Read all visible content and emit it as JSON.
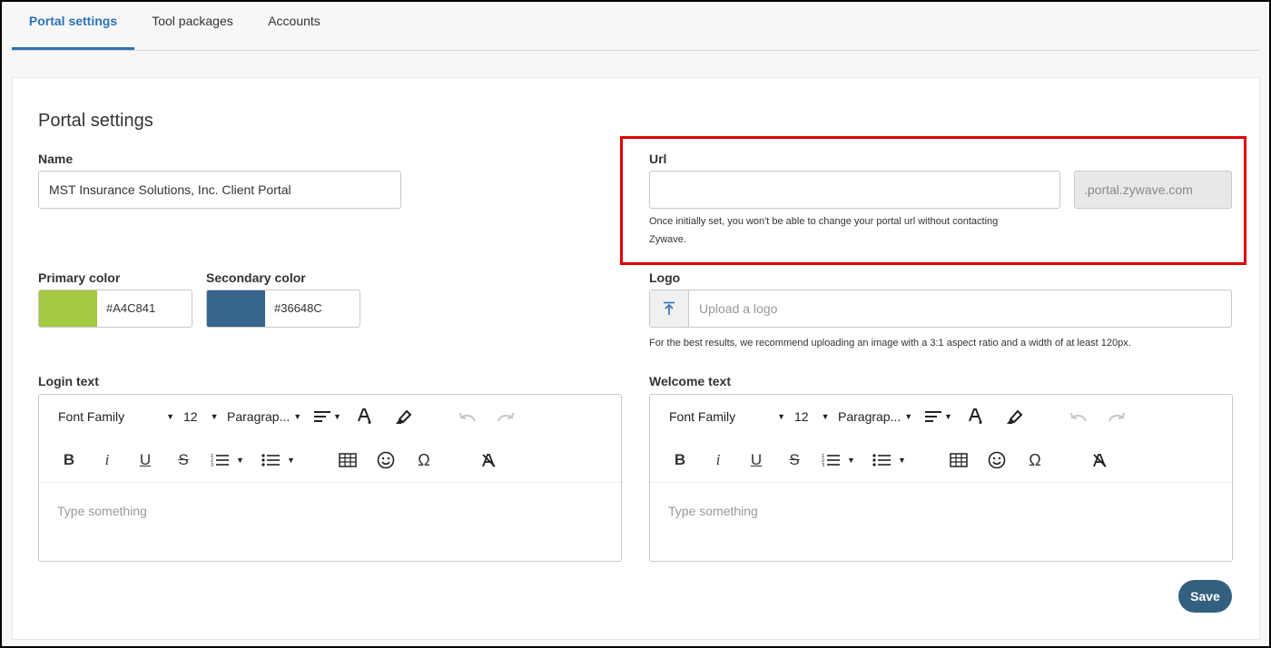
{
  "tabs": [
    {
      "label": "Portal settings",
      "active": true
    },
    {
      "label": "Tool packages",
      "active": false
    },
    {
      "label": "Accounts",
      "active": false
    }
  ],
  "page_title": "Portal settings",
  "name": {
    "label": "Name",
    "value": "MST Insurance Solutions, Inc. Client Portal"
  },
  "url": {
    "label": "Url",
    "value": "",
    "suffix": ".portal.zywave.com",
    "hint_line1": "Once initially set, you won't be able to change your portal url without contacting",
    "hint_line2": "Zywave."
  },
  "primary_color": {
    "label": "Primary color",
    "value": "#A4C841",
    "swatch": "#A4C841"
  },
  "secondary_color": {
    "label": "Secondary color",
    "value": "#36648C",
    "swatch": "#36648C"
  },
  "logo": {
    "label": "Logo",
    "placeholder": "Upload a logo",
    "hint": "For the best results, we recommend uploading an image with a 3:1 aspect ratio and a width of at least 120px."
  },
  "login_text": {
    "label": "Login text",
    "font_family": "Font Family",
    "font_size": "12",
    "paragraph": "Paragrap...",
    "placeholder": "Type something"
  },
  "welcome_text": {
    "label": "Welcome text",
    "font_family": "Font Family",
    "font_size": "12",
    "paragraph": "Paragrap...",
    "placeholder": "Type something"
  },
  "save_label": "Save",
  "colors": {
    "accent": "#2D72B8",
    "save_button": "#34607F",
    "highlight_box": "#E00000"
  }
}
